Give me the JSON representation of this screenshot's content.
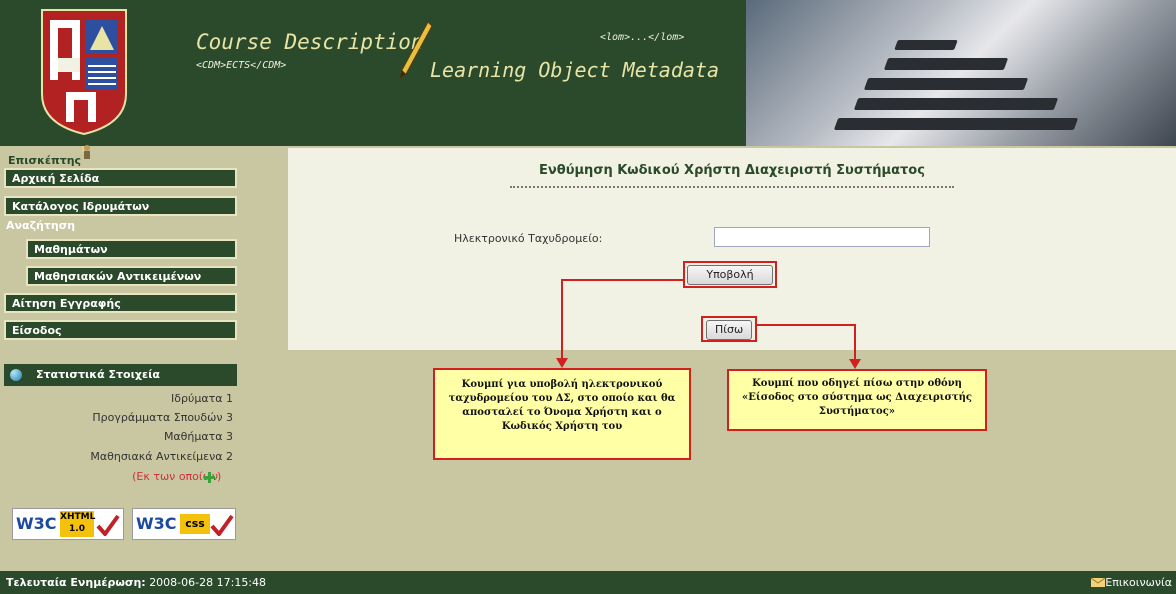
{
  "header": {
    "course_title": "Course Description",
    "course_sub": "<CDM>ECTS</CDM>",
    "lom_tag": "<lom>...</lom>",
    "lom_title": "Learning Object Metadata"
  },
  "user": {
    "role": "Επισκέπτης"
  },
  "nav": {
    "home": "Αρχική Σελίδα",
    "institutions": "Κατάλογος Ιδρυμάτων",
    "search": "Αναζήτηση",
    "courses": "Μαθημάτων",
    "learning_objects": "Μαθησιακών Αντικειμένων",
    "register": "Αίτηση Εγγραφής",
    "login": "Είσοδος"
  },
  "stats": {
    "title": "Στατιστικά Στοιχεία",
    "rows": [
      "Ιδρύματα 1",
      "Προγράμματα Σπουδών 3",
      "Μαθήματα 3",
      "Μαθησιακά Αντικείμενα 2"
    ],
    "of_which_prefix": "(",
    "of_which_link": "Εκ των οποίων",
    "of_which_suffix": ")"
  },
  "badges": {
    "xhtml": "XHTML",
    "xhtml_ver": "1.0",
    "w3c": "W3C",
    "css": "css"
  },
  "form": {
    "title": "Ενθύμηση Κωδικού Χρήστη Διαχειριστή Συστήματος",
    "email_label": "Ηλεκτρονικό Ταχυδρομείο:",
    "email_value": "",
    "submit": "Υποβολή",
    "back": "Πίσω"
  },
  "callouts": {
    "submit_note": "Κουμπί για υποβολή ηλεκτρονικού ταχυδρομείου του ΔΣ, στο οποίο και θα αποσταλεί το Όνομα Χρήστη και ο Κωδικός Χρήστη του",
    "back_note": "Κουμπί που οδηγεί πίσω στην οθόνη «Είσοδος στο σύστημα ως Διαχειριστής Συστήματος»"
  },
  "footer": {
    "last_update_label": "Τελευταία Ενημέρωση:",
    "last_update_value": "2008-06-28 17:15:48",
    "contact": "Επικοινωνία"
  },
  "colors": {
    "brand_green": "#2b4a2b",
    "page_bg": "#c8c7a1",
    "callout_bg": "#ffffa6",
    "highlight_red": "#d02020"
  }
}
